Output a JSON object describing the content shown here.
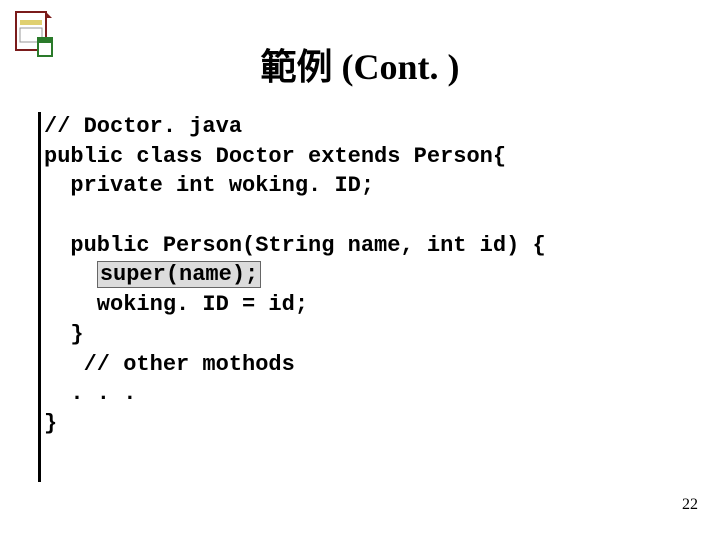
{
  "title": "範例 (Cont. )",
  "code": {
    "l1": "// Doctor. java",
    "l2": "public class Doctor extends Person{",
    "l3": "  private int woking. ID;",
    "l4": "",
    "l5": "  public Person(String name, int id) {",
    "l6_pre": "    ",
    "l6_hl": "super(name);",
    "l7": "    woking. ID = id;",
    "l8": "  }",
    "l9": "   // other mothods",
    "l10": "  . . .",
    "l11": "}"
  },
  "page_number": "22"
}
